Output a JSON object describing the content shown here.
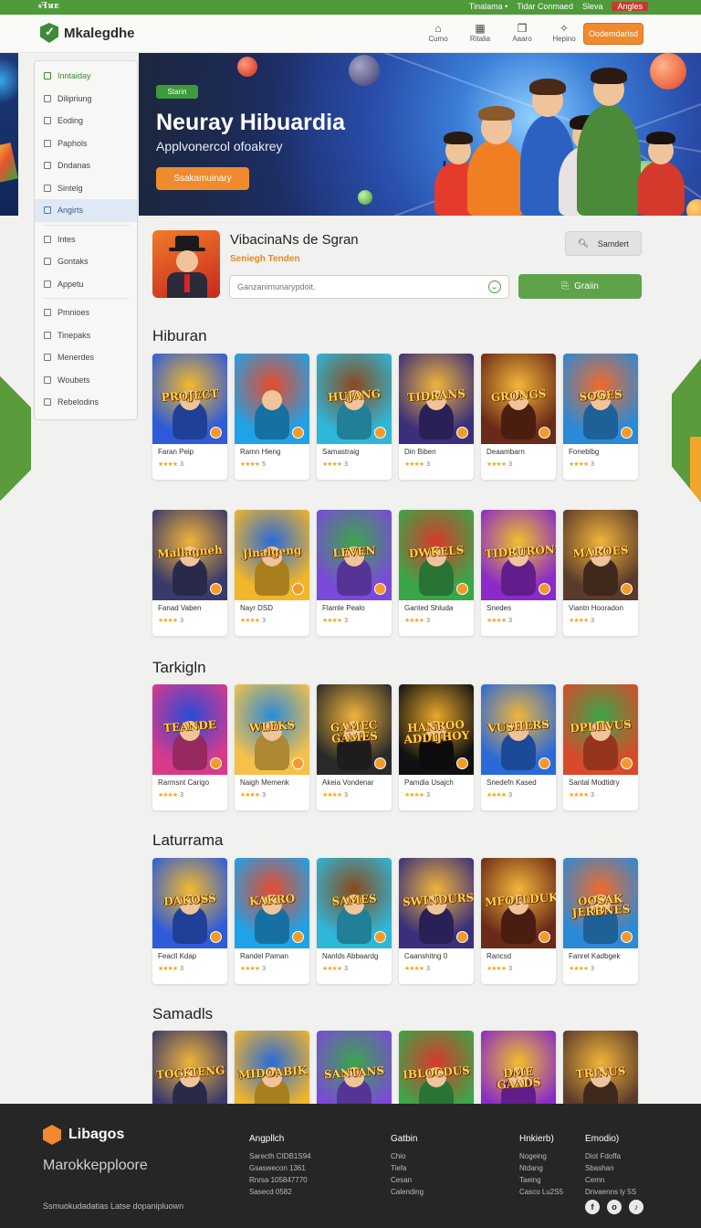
{
  "topbar": {
    "left_text": "ᵴꟻᴚᴇ",
    "items": [
      "Tinalama •",
      "Tidar Conmaed",
      "Sleva",
      "Angles"
    ]
  },
  "header": {
    "logo_text": "Mkalegdhe",
    "nav": [
      {
        "label": "Cumo",
        "icon": "home-icon"
      },
      {
        "label": "Ritalia",
        "icon": "grid-icon"
      },
      {
        "label": "Aaaro",
        "icon": "bookmark-icon"
      },
      {
        "label": "Hepino",
        "icon": "star-icon"
      }
    ],
    "cta_label": "Oodemdarisd"
  },
  "sidebar": {
    "items": [
      {
        "label": "Inntaiday",
        "style": "green"
      },
      {
        "label": "Dilipriung",
        "style": ""
      },
      {
        "label": "Eoding",
        "style": ""
      },
      {
        "label": "Paphols",
        "style": ""
      },
      {
        "label": "Dndanas",
        "style": ""
      },
      {
        "label": "Sintelg",
        "style": ""
      },
      {
        "label": "Angirts",
        "style": "active"
      },
      {
        "label": "Intes",
        "style": ""
      },
      {
        "label": "Gontaks",
        "style": ""
      },
      {
        "label": "Appetu",
        "style": ""
      },
      {
        "label": "Pmnioes",
        "style": ""
      },
      {
        "label": "Tinepaks",
        "style": ""
      },
      {
        "label": "Menerdes",
        "style": ""
      },
      {
        "label": "Woubets",
        "style": ""
      },
      {
        "label": "Rebelodins",
        "style": ""
      }
    ]
  },
  "hero": {
    "chip": "Starin",
    "title": "Neuray Hibuardia",
    "subtitle": "Applvonercol ofoakrey",
    "button": "Ssakamuinary"
  },
  "featured": {
    "title": "VibacinaNs de Sgran",
    "subtitle": "Seniegh Tenden",
    "search_placeholder": "Ganzanimunarypdoit.",
    "search_button": "Samdert",
    "install_button": "Graiin"
  },
  "sections": [
    {
      "title": "Hiburan",
      "rows": [
        [
          {
            "art": "PROJECT",
            "name": "Faran Peip",
            "rating": 3
          },
          {
            "art": "",
            "name": "Ramn Hieng",
            "rating": 5
          },
          {
            "art": "HUJANG",
            "name": "Samastraig",
            "rating": 3
          },
          {
            "art": "TIDRANS",
            "name": "Din Biben",
            "rating": 3
          },
          {
            "art": "GRONGS",
            "name": "Deaambarn",
            "rating": 3
          },
          {
            "art": "SOGES",
            "name": "Foneblbg",
            "rating": 3
          }
        ],
        [
          {
            "art": "Mallagneh",
            "name": "Fanad Vaben",
            "rating": 3
          },
          {
            "art": "Jlnalgeng",
            "name": "Nayr DSD",
            "rating": 3
          },
          {
            "art": "LEVEN",
            "name": "Flamle Pealo",
            "rating": 3
          },
          {
            "art": "DWKELS",
            "name": "Ganted Shluda",
            "rating": 3
          },
          {
            "art": "TIDRURONZ",
            "name": "Snedes",
            "rating": 3
          },
          {
            "art": "MAROES",
            "name": "Viantn Hooradon",
            "rating": 3
          }
        ]
      ]
    },
    {
      "title": "Tarkigln",
      "rows": [
        [
          {
            "art": "TEANDE",
            "name": "Rarmsnt Carigo",
            "rating": 3
          },
          {
            "art": "WLEKS",
            "name": "Naigh Memenk",
            "rating": 3
          },
          {
            "art": "GAMEC GAMES",
            "name": "Akeia Vondenar",
            "rating": 3
          },
          {
            "art": "HANROO ADDIJHOY",
            "name": "Pamdia Usajch",
            "rating": 3
          },
          {
            "art": "VUSHERS",
            "name": "Snedefn Kased",
            "rating": 3
          },
          {
            "art": "DPLIIVUS",
            "name": "Santal Modtidry",
            "rating": 3
          }
        ]
      ]
    },
    {
      "title": "Laturrama",
      "rows": [
        [
          {
            "art": "DAKOSS",
            "name": "Feacll Kdap",
            "rating": 3
          },
          {
            "art": "KAKRO",
            "name": "Randel Paman",
            "rating": 3
          },
          {
            "art": "SAMES",
            "name": "Nanlds Abbaardg",
            "rating": 3
          },
          {
            "art": "SWINDURS",
            "name": "Caanshitng 0",
            "rating": 3
          },
          {
            "art": "MFOFLDUK",
            "name": "Rancsd",
            "rating": 3
          },
          {
            "art": "OOSAK JERBNES",
            "name": "Fanrel Kadbgek",
            "rating": 3
          }
        ]
      ]
    },
    {
      "title": "Samadls",
      "rows": [
        [
          {
            "art": "TOCKIENG",
            "name": "",
            "rating": 0
          },
          {
            "art": "MIDOABIK",
            "name": "",
            "rating": 0
          },
          {
            "art": "SANTANS",
            "name": "",
            "rating": 0
          },
          {
            "art": "IBLOCDUS",
            "name": "",
            "rating": 0
          },
          {
            "art": "DME GAADS",
            "name": "",
            "rating": 0
          },
          {
            "art": "TRINUS",
            "name": "",
            "rating": 0
          }
        ]
      ]
    }
  ],
  "footer": {
    "logo": "Libagos",
    "brand": "Marokkepploore",
    "copyright": "Ssmuokudadatias Latse dopanipluown",
    "columns": [
      {
        "heading": "Angpllch",
        "items": [
          "Sarecth CIDB1S94",
          "Gsaswecon 1361",
          "Rnrsa 105847770",
          "Sasecd 0582"
        ]
      },
      {
        "heading": "Gatbin",
        "items": [
          "Chio",
          "Tiefa",
          "Cesan",
          "Calending"
        ]
      },
      {
        "heading": "Hnkierb)",
        "items": [
          "Nogeing",
          "Ntdang",
          "Taeing",
          "Casco Lu2S5"
        ]
      },
      {
        "heading": "Emodio)",
        "items": [
          "Diot Fdoffa",
          "Sbashan",
          "Cemn",
          "Dnvaenns ly 5S"
        ]
      }
    ],
    "social": [
      "f",
      "o",
      "♪"
    ]
  },
  "colors": {
    "brand_green": "#4f9a3a",
    "accent_orange": "#ef8a2e",
    "footer_bg": "#262626"
  }
}
